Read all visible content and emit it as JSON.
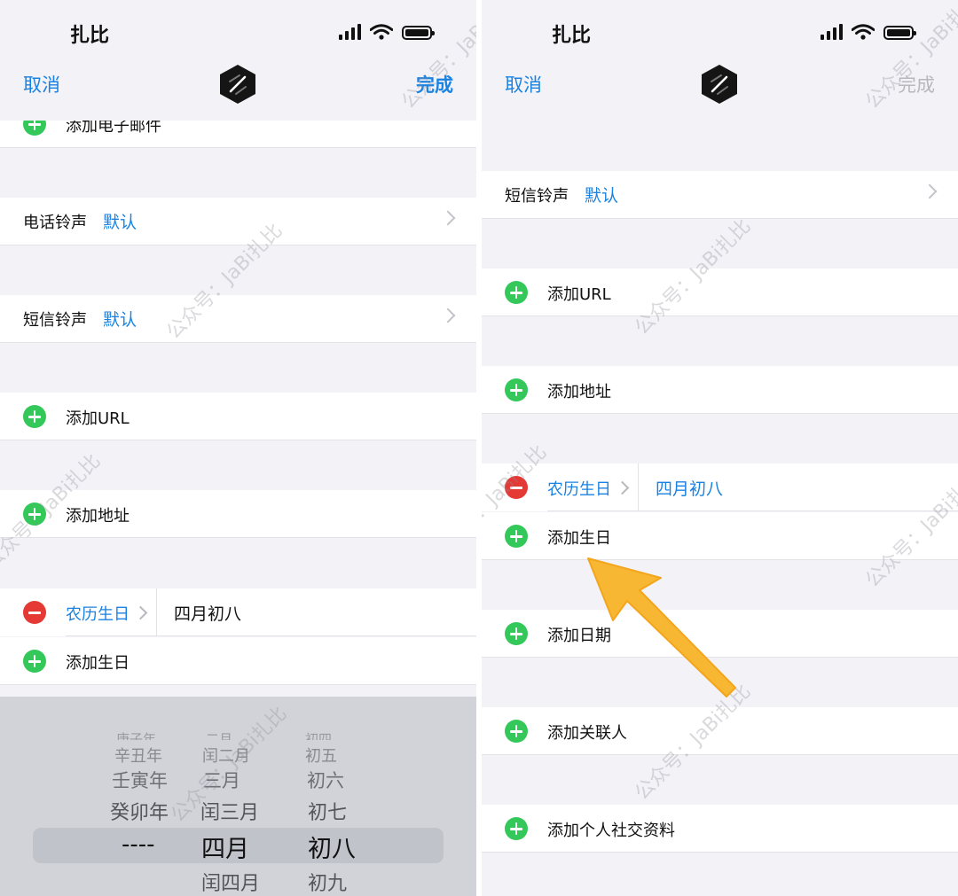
{
  "status": {
    "carrier": "扎比"
  },
  "nav": {
    "cancel": "取消",
    "done": "完成"
  },
  "left": {
    "partial_row": "添加电子邮件",
    "call_ringtone": {
      "label": "电话铃声",
      "value": "默认"
    },
    "text_ringtone": {
      "label": "短信铃声",
      "value": "默认"
    },
    "add_url": "添加URL",
    "add_address": "添加地址",
    "lunar_birthday": {
      "label": "农历生日",
      "value": "四月初八"
    },
    "add_birthday": "添加生日",
    "picker": {
      "col1": [
        "庚子年",
        "辛丑年",
        "壬寅年",
        "癸卯年",
        "----"
      ],
      "col2": [
        "二月",
        "闰二月",
        "三月",
        "闰三月",
        "四月",
        "闰四月"
      ],
      "col3": [
        "初四",
        "初五",
        "初六",
        "初七",
        "初八",
        "初九"
      ]
    }
  },
  "right": {
    "text_ringtone": {
      "label": "短信铃声",
      "value": "默认"
    },
    "add_url": "添加URL",
    "add_address": "添加地址",
    "lunar_birthday": {
      "label": "农历生日",
      "value": "四月初八"
    },
    "add_birthday": "添加生日",
    "add_date": "添加日期",
    "add_related": "添加关联人",
    "add_social": "添加个人社交资料"
  },
  "watermark": "公众号：JaBi扎比",
  "colors": {
    "accent": "#1a82e2",
    "add_green": "#34c759",
    "remove_red": "#e53935",
    "arrow": "#f7b733"
  }
}
